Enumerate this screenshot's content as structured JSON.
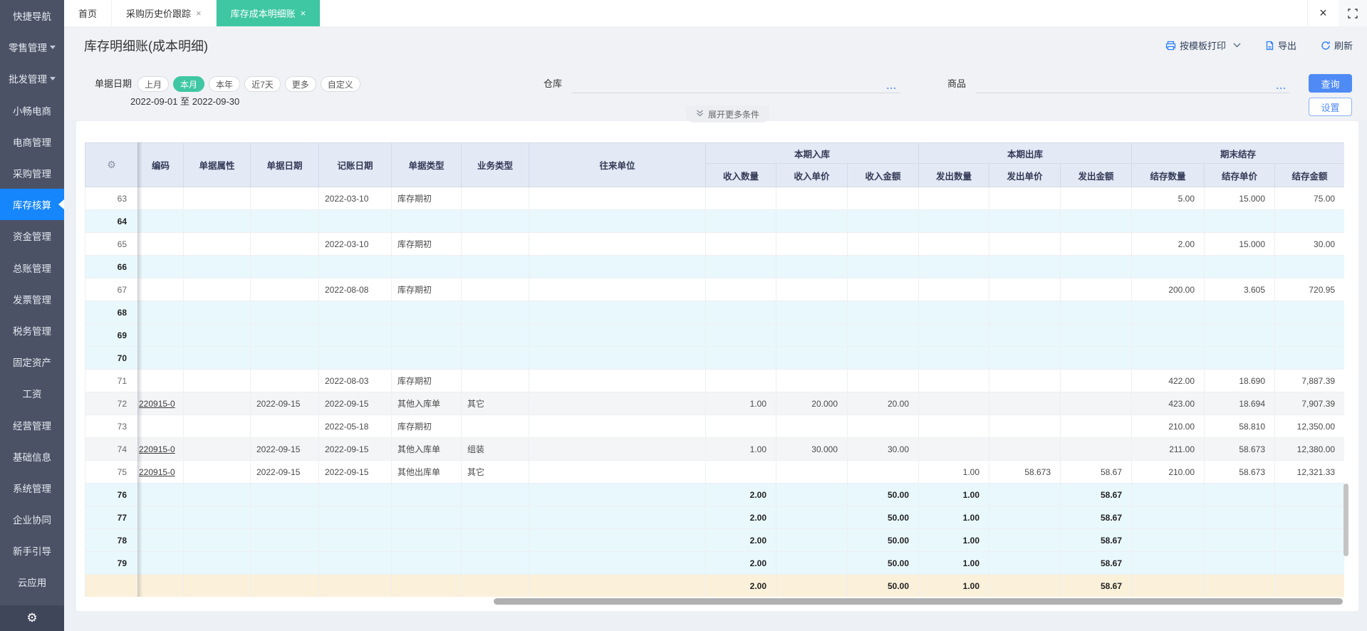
{
  "colors": {
    "sidebar_bg": "#4b5266",
    "sidebar_active_blue": "#1586fb",
    "tab_active_green": "#3fc7a3",
    "accent_blue": "#4f8bf5",
    "table_header_bg": "#e3e9f5",
    "row_cyan": "#e9f8fd",
    "row_gray": "#f4f5f7",
    "row_highlight_yellow": "#fbf0d9"
  },
  "icons": {
    "close": "×",
    "gear": "⚙",
    "ellipsis": "...",
    "fullscreen": "fullscreen-corners",
    "printer": "printer",
    "export": "document-export",
    "refresh": "refresh-arrow",
    "chevron_down": "chevron-down",
    "double_chevron_down": "double-chevron-down"
  },
  "sidebar": {
    "items": [
      {
        "label": "快捷导航",
        "active": false,
        "arrow": false
      },
      {
        "label": "零售管理",
        "active": false,
        "arrow": true
      },
      {
        "label": "批发管理",
        "active": false,
        "arrow": true
      },
      {
        "label": "小畅电商",
        "active": false,
        "arrow": false
      },
      {
        "label": "电商管理",
        "active": false,
        "arrow": false
      },
      {
        "label": "采购管理",
        "active": false,
        "arrow": false
      },
      {
        "label": "库存核算",
        "active": true,
        "arrow": false
      },
      {
        "label": "资金管理",
        "active": false,
        "arrow": false
      },
      {
        "label": "总账管理",
        "active": false,
        "arrow": false
      },
      {
        "label": "发票管理",
        "active": false,
        "arrow": false
      },
      {
        "label": "税务管理",
        "active": false,
        "arrow": false
      },
      {
        "label": "固定资产",
        "active": false,
        "arrow": false
      },
      {
        "label": "工资",
        "active": false,
        "arrow": false
      },
      {
        "label": "经营管理",
        "active": false,
        "arrow": false
      },
      {
        "label": "基础信息",
        "active": false,
        "arrow": false
      },
      {
        "label": "系统管理",
        "active": false,
        "arrow": false
      },
      {
        "label": "企业协同",
        "active": false,
        "arrow": false
      },
      {
        "label": "新手引导",
        "active": false,
        "arrow": false
      },
      {
        "label": "云应用",
        "active": false,
        "arrow": false
      }
    ]
  },
  "tabs": [
    {
      "label": "首页",
      "closable": false,
      "active": false
    },
    {
      "label": "采购历史价跟踪",
      "closable": true,
      "active": false
    },
    {
      "label": "库存成本明细账",
      "closable": true,
      "active": true
    }
  ],
  "title_bar": {
    "title": "库存明细账(成本明细)",
    "print_label": "按模板打印",
    "export_label": "导出",
    "refresh_label": "刷新"
  },
  "filters": {
    "date_label": "单据日期",
    "date_pills": [
      {
        "label": "上月",
        "active": false
      },
      {
        "label": "本月",
        "active": true
      },
      {
        "label": "本年",
        "active": false
      },
      {
        "label": "近7天",
        "active": false
      },
      {
        "label": "更多",
        "active": false
      },
      {
        "label": "自定义",
        "active": false
      }
    ],
    "date_from": "2022-09-01",
    "date_to_word": "至",
    "date_to": "2022-09-30",
    "warehouse_label": "仓库",
    "goods_label": "商品",
    "ellipsis": "...",
    "query_label": "查询",
    "settings_label": "设置"
  },
  "expand_bar": {
    "label": "展开更多条件"
  },
  "table": {
    "fixed_headers": [
      "编码",
      "单据属性",
      "单据日期",
      "记账日期",
      "单据类型",
      "业务类型",
      "往来单位"
    ],
    "groups": [
      {
        "label": "本期入库",
        "columns": [
          "收入数量",
          "收入单价",
          "收入金额"
        ]
      },
      {
        "label": "本期出库",
        "columns": [
          "发出数量",
          "发出单价",
          "发出金额"
        ]
      },
      {
        "label": "期末结存",
        "columns": [
          "结存数量",
          "结存单价",
          "结存金额"
        ]
      }
    ],
    "rows": [
      {
        "num": "63",
        "style": "white",
        "code": "",
        "doc_attr": "",
        "doc_date": "",
        "book_date": "2022-03-10",
        "doc_type": "库存期初",
        "biz_type": "",
        "partner": "",
        "in_qty": "",
        "in_price": "",
        "in_amt": "",
        "out_qty": "",
        "out_price": "",
        "out_amt": "",
        "bal_qty": "5.00",
        "bal_price": "15.000",
        "bal_amt": "75.00"
      },
      {
        "num": "64",
        "style": "cyan",
        "code": "",
        "doc_attr": "",
        "doc_date": "",
        "book_date": "",
        "doc_type": "",
        "biz_type": "",
        "partner": "",
        "in_qty": "",
        "in_price": "",
        "in_amt": "",
        "out_qty": "",
        "out_price": "",
        "out_amt": "",
        "bal_qty": "",
        "bal_price": "",
        "bal_amt": ""
      },
      {
        "num": "65",
        "style": "white",
        "code": "",
        "doc_attr": "",
        "doc_date": "",
        "book_date": "2022-03-10",
        "doc_type": "库存期初",
        "biz_type": "",
        "partner": "",
        "in_qty": "",
        "in_price": "",
        "in_amt": "",
        "out_qty": "",
        "out_price": "",
        "out_amt": "",
        "bal_qty": "2.00",
        "bal_price": "15.000",
        "bal_amt": "30.00"
      },
      {
        "num": "66",
        "style": "cyan",
        "code": "",
        "doc_attr": "",
        "doc_date": "",
        "book_date": "",
        "doc_type": "",
        "biz_type": "",
        "partner": "",
        "in_qty": "",
        "in_price": "",
        "in_amt": "",
        "out_qty": "",
        "out_price": "",
        "out_amt": "",
        "bal_qty": "",
        "bal_price": "",
        "bal_amt": ""
      },
      {
        "num": "67",
        "style": "white",
        "code": "",
        "doc_attr": "",
        "doc_date": "",
        "book_date": "2022-08-08",
        "doc_type": "库存期初",
        "biz_type": "",
        "partner": "",
        "in_qty": "",
        "in_price": "",
        "in_amt": "",
        "out_qty": "",
        "out_price": "",
        "out_amt": "",
        "bal_qty": "200.00",
        "bal_price": "3.605",
        "bal_amt": "720.95"
      },
      {
        "num": "68",
        "style": "cyan",
        "code": "",
        "doc_attr": "",
        "doc_date": "",
        "book_date": "",
        "doc_type": "",
        "biz_type": "",
        "partner": "",
        "in_qty": "",
        "in_price": "",
        "in_amt": "",
        "out_qty": "",
        "out_price": "",
        "out_amt": "",
        "bal_qty": "",
        "bal_price": "",
        "bal_amt": ""
      },
      {
        "num": "69",
        "style": "cyan",
        "code": "",
        "doc_attr": "",
        "doc_date": "",
        "book_date": "",
        "doc_type": "",
        "biz_type": "",
        "partner": "",
        "in_qty": "",
        "in_price": "",
        "in_amt": "",
        "out_qty": "",
        "out_price": "",
        "out_amt": "",
        "bal_qty": "",
        "bal_price": "",
        "bal_amt": ""
      },
      {
        "num": "70",
        "style": "cyan",
        "code": "",
        "doc_attr": "",
        "doc_date": "",
        "book_date": "",
        "doc_type": "",
        "biz_type": "",
        "partner": "",
        "in_qty": "",
        "in_price": "",
        "in_amt": "",
        "out_qty": "",
        "out_price": "",
        "out_amt": "",
        "bal_qty": "",
        "bal_price": "",
        "bal_amt": ""
      },
      {
        "num": "71",
        "style": "white",
        "code": "",
        "doc_attr": "",
        "doc_date": "",
        "book_date": "2022-08-03",
        "doc_type": "库存期初",
        "biz_type": "",
        "partner": "",
        "in_qty": "",
        "in_price": "",
        "in_amt": "",
        "out_qty": "",
        "out_price": "",
        "out_amt": "",
        "bal_qty": "422.00",
        "bal_price": "18.690",
        "bal_amt": "7,887.39"
      },
      {
        "num": "72",
        "style": "gray",
        "code": "220915-0",
        "doc_attr": "",
        "doc_date": "2022-09-15",
        "book_date": "2022-09-15",
        "doc_type": "其他入库单",
        "biz_type": "其它",
        "partner": "",
        "in_qty": "1.00",
        "in_price": "20.000",
        "in_amt": "20.00",
        "out_qty": "",
        "out_price": "",
        "out_amt": "",
        "bal_qty": "423.00",
        "bal_price": "18.694",
        "bal_amt": "7,907.39"
      },
      {
        "num": "73",
        "style": "white",
        "code": "",
        "doc_attr": "",
        "doc_date": "",
        "book_date": "2022-05-18",
        "doc_type": "库存期初",
        "biz_type": "",
        "partner": "",
        "in_qty": "",
        "in_price": "",
        "in_amt": "",
        "out_qty": "",
        "out_price": "",
        "out_amt": "",
        "bal_qty": "210.00",
        "bal_price": "58.810",
        "bal_amt": "12,350.00"
      },
      {
        "num": "74",
        "style": "gray",
        "code": "220915-0",
        "doc_attr": "",
        "doc_date": "2022-09-15",
        "book_date": "2022-09-15",
        "doc_type": "其他入库单",
        "biz_type": "组装",
        "partner": "",
        "in_qty": "1.00",
        "in_price": "30.000",
        "in_amt": "30.00",
        "out_qty": "",
        "out_price": "",
        "out_amt": "",
        "bal_qty": "211.00",
        "bal_price": "58.673",
        "bal_amt": "12,380.00"
      },
      {
        "num": "75",
        "style": "white",
        "code": "220915-0",
        "doc_attr": "",
        "doc_date": "2022-09-15",
        "book_date": "2022-09-15",
        "doc_type": "其他出库单",
        "biz_type": "其它",
        "partner": "",
        "in_qty": "",
        "in_price": "",
        "in_amt": "",
        "out_qty": "1.00",
        "out_price": "58.673",
        "out_amt": "58.67",
        "bal_qty": "210.00",
        "bal_price": "58.673",
        "bal_amt": "12,321.33"
      },
      {
        "num": "76",
        "style": "sum",
        "code": "",
        "doc_attr": "",
        "doc_date": "",
        "book_date": "",
        "doc_type": "",
        "biz_type": "",
        "partner": "",
        "in_qty": "2.00",
        "in_price": "",
        "in_amt": "50.00",
        "out_qty": "1.00",
        "out_price": "",
        "out_amt": "58.67",
        "bal_qty": "",
        "bal_price": "",
        "bal_amt": ""
      },
      {
        "num": "77",
        "style": "sum",
        "code": "",
        "doc_attr": "",
        "doc_date": "",
        "book_date": "",
        "doc_type": "",
        "biz_type": "",
        "partner": "",
        "in_qty": "2.00",
        "in_price": "",
        "in_amt": "50.00",
        "out_qty": "1.00",
        "out_price": "",
        "out_amt": "58.67",
        "bal_qty": "",
        "bal_price": "",
        "bal_amt": ""
      },
      {
        "num": "78",
        "style": "sum",
        "code": "",
        "doc_attr": "",
        "doc_date": "",
        "book_date": "",
        "doc_type": "",
        "biz_type": "",
        "partner": "",
        "in_qty": "2.00",
        "in_price": "",
        "in_amt": "50.00",
        "out_qty": "1.00",
        "out_price": "",
        "out_amt": "58.67",
        "bal_qty": "",
        "bal_price": "",
        "bal_amt": ""
      },
      {
        "num": "79",
        "style": "sum",
        "code": "",
        "doc_attr": "",
        "doc_date": "",
        "book_date": "",
        "doc_type": "",
        "biz_type": "",
        "partner": "",
        "in_qty": "2.00",
        "in_price": "",
        "in_amt": "50.00",
        "out_qty": "1.00",
        "out_price": "",
        "out_amt": "58.67",
        "bal_qty": "",
        "bal_price": "",
        "bal_amt": ""
      },
      {
        "num": "",
        "style": "total",
        "code": "",
        "doc_attr": "",
        "doc_date": "",
        "book_date": "",
        "doc_type": "",
        "biz_type": "",
        "partner": "",
        "in_qty": "2.00",
        "in_price": "",
        "in_amt": "50.00",
        "out_qty": "1.00",
        "out_price": "",
        "out_amt": "58.67",
        "bal_qty": "",
        "bal_price": "",
        "bal_amt": ""
      }
    ]
  }
}
